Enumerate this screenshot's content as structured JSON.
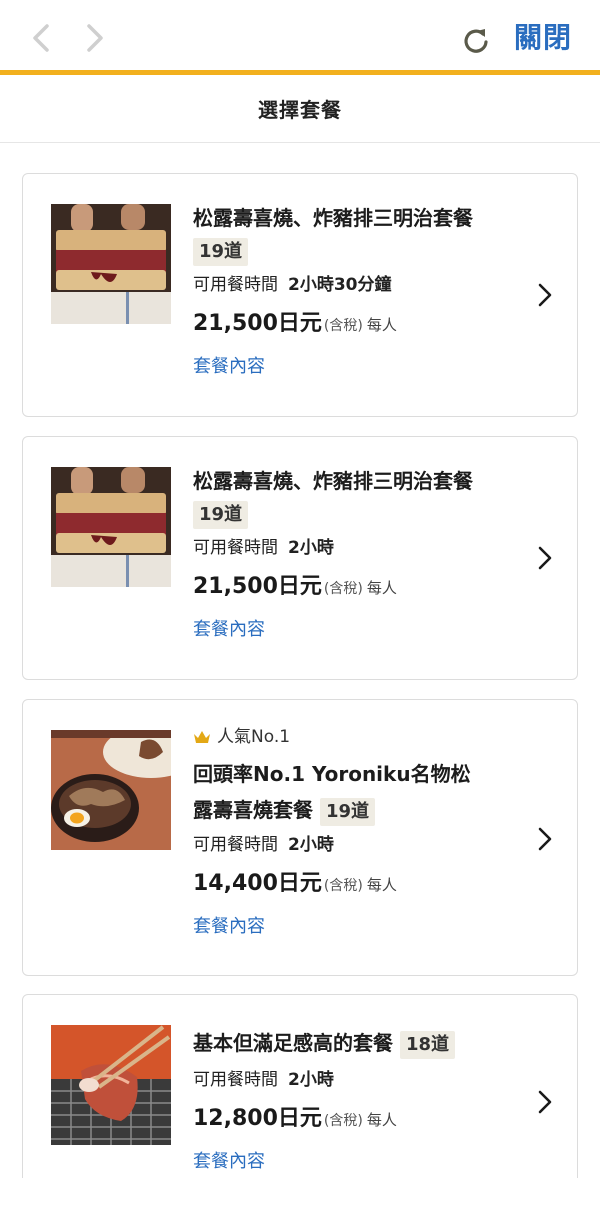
{
  "nav": {
    "close_label": "關閉",
    "back_icon": "chevron-left-icon",
    "forward_icon": "chevron-right-icon",
    "reload_icon": "reload-icon",
    "accent_color": "#f2b01e",
    "link_color": "#2a6dbf"
  },
  "page": {
    "title": "選擇套餐"
  },
  "courses": [
    {
      "name": "松露壽喜燒、炸豬排三明治套餐",
      "dishes": "19道",
      "time_label": "可用餐時間",
      "time_value": "2小時30分鐘",
      "price": "21,500日元",
      "tax": "(含稅)",
      "per": "每人",
      "link": "套餐內容"
    },
    {
      "name": "松露壽喜燒、炸豬排三明治套餐",
      "dishes": "19道",
      "time_label": "可用餐時間",
      "time_value": "2小時",
      "price": "21,500日元",
      "tax": "(含稅)",
      "per": "每人",
      "link": "套餐內容"
    },
    {
      "popular": "人氣No.1",
      "name_line1": "回頭率No.1 Yoroniku名物松",
      "name_line2": "露壽喜燒套餐",
      "dishes": "19道",
      "time_label": "可用餐時間",
      "time_value": "2小時",
      "price": "14,400日元",
      "tax": "(含稅)",
      "per": "每人",
      "link": "套餐內容"
    },
    {
      "name": "基本但滿足感高的套餐",
      "dishes": "18道",
      "time_label": "可用餐時間",
      "time_value": "2小時",
      "price": "12,800日元",
      "tax": "(含稅)",
      "per": "每人",
      "link": "套餐內容"
    }
  ]
}
